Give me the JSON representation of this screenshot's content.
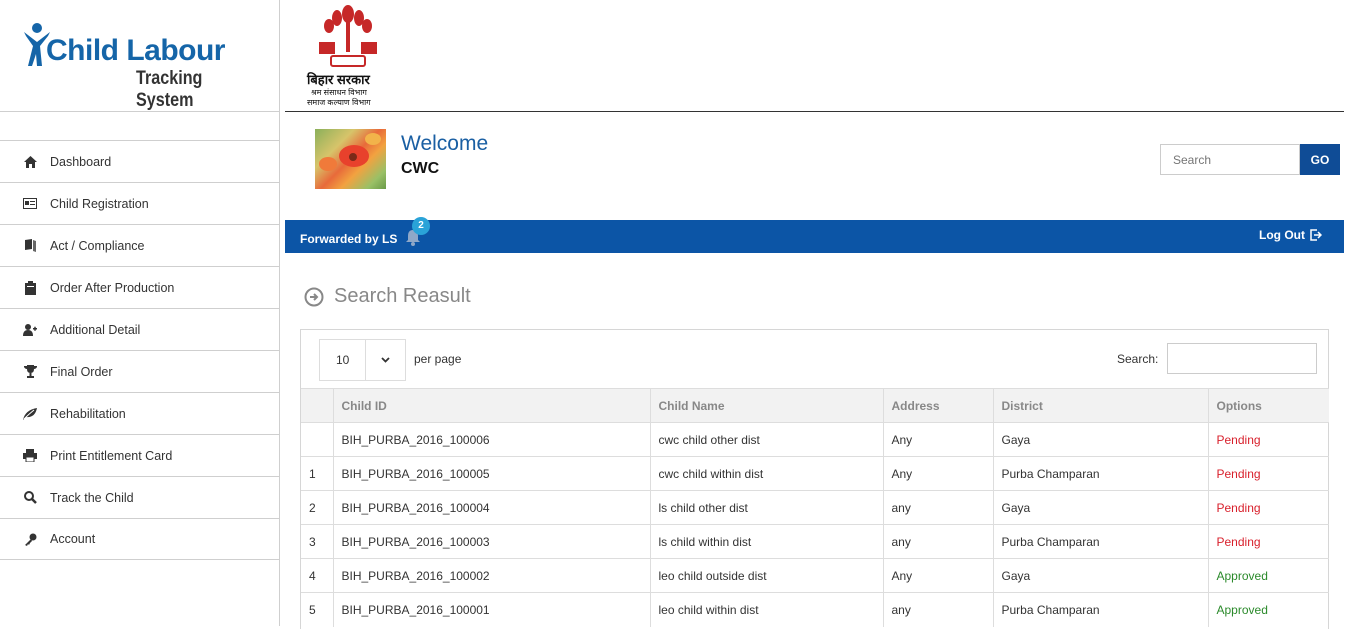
{
  "logo": {
    "title": "Child Labour",
    "subtitle": "Tracking System"
  },
  "emblem": {
    "line1": "बिहार सरकार",
    "line2": "श्रम संसाधन विभाग",
    "line3": "समाज कल्याण विभाग"
  },
  "sidebar": {
    "items": [
      {
        "label": "Dashboard",
        "icon": "home-icon"
      },
      {
        "label": "Child Registration",
        "icon": "id-card-icon"
      },
      {
        "label": "Act / Compliance",
        "icon": "book-icon"
      },
      {
        "label": "Order After Production",
        "icon": "clipboard-icon"
      },
      {
        "label": "Additional Detail",
        "icon": "user-plus-icon"
      },
      {
        "label": "Final Order",
        "icon": "trophy-icon"
      },
      {
        "label": "Rehabilitation",
        "icon": "leaf-icon"
      },
      {
        "label": "Print Entitlement Card",
        "icon": "print-icon"
      },
      {
        "label": "Track the Child",
        "icon": "search-icon"
      },
      {
        "label": "Account",
        "icon": "key-icon"
      }
    ]
  },
  "welcome": {
    "greeting": "Welcome",
    "user": "CWC"
  },
  "top_search": {
    "placeholder": "Search",
    "button": "GO"
  },
  "bluebar": {
    "forwarded": "Forwarded by LS",
    "badge": "2",
    "logout": "Log Out"
  },
  "section": {
    "title": "Search Reasult"
  },
  "table_controls": {
    "per_page_value": "10",
    "per_page_label": "per page",
    "search_label": "Search:"
  },
  "table": {
    "headers": [
      "",
      "Child ID",
      "Child Name",
      "Address",
      "District",
      "Options"
    ],
    "rows": [
      {
        "idx": "",
        "child_id": "BIH_PURBA_2016_100006",
        "name": "cwc child other dist",
        "address": "Any",
        "district": "Gaya",
        "option": "Pending"
      },
      {
        "idx": "1",
        "child_id": "BIH_PURBA_2016_100005",
        "name": "cwc child within dist",
        "address": "Any",
        "district": "Purba Champaran",
        "option": "Pending"
      },
      {
        "idx": "2",
        "child_id": "BIH_PURBA_2016_100004",
        "name": "ls child other dist",
        "address": "any",
        "district": "Gaya",
        "option": "Pending"
      },
      {
        "idx": "3",
        "child_id": "BIH_PURBA_2016_100003",
        "name": "ls child within dist",
        "address": "any",
        "district": "Purba Champaran",
        "option": "Pending"
      },
      {
        "idx": "4",
        "child_id": "BIH_PURBA_2016_100002",
        "name": "leo child outside dist",
        "address": "Any",
        "district": "Gaya",
        "option": "Approved"
      },
      {
        "idx": "5",
        "child_id": "BIH_PURBA_2016_100001",
        "name": "leo child within dist",
        "address": "any",
        "district": "Purba Champaran",
        "option": "Approved"
      }
    ]
  },
  "colors": {
    "primary": "#0c55a6",
    "pending": "#d81f2b",
    "approved": "#2b8a2b"
  }
}
